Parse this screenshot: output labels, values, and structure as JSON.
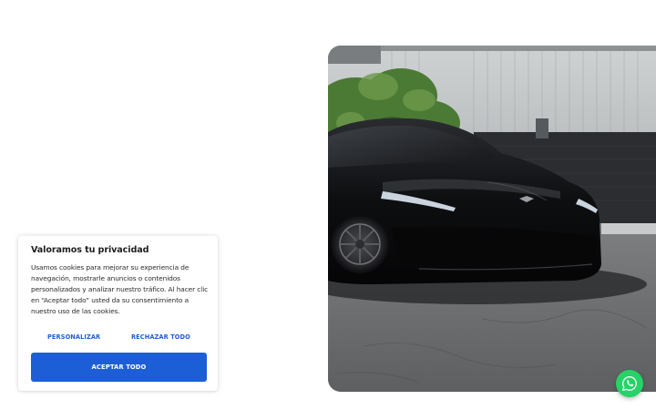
{
  "hero": {
    "image_alt": "Black Tesla electric car parked on asphalt",
    "alt_attr": "Black Tesla electric car parked on asphalt"
  },
  "cookie_banner": {
    "title": "Valoramos tu privacidad",
    "body_lines": [
      "Usamos cookies para mejorar su experiencia de",
      "navegación, mostrarle anuncios o contenidos",
      "personalizados y analizar nuestro tráfico. Al hacer clic",
      "en “Aceptar todo” usted da su consentimiento a",
      "nuestro uso de las cookies."
    ],
    "customize_label": "Personalizar",
    "reject_label": "Rechazar todo",
    "accept_label": "Aceptar todo"
  },
  "floating": {
    "whatsapp_icon": "whatsapp-icon"
  },
  "colors": {
    "accent": "#1c5ed6",
    "whatsapp": "#25d366",
    "text": "#1f1f1f"
  }
}
